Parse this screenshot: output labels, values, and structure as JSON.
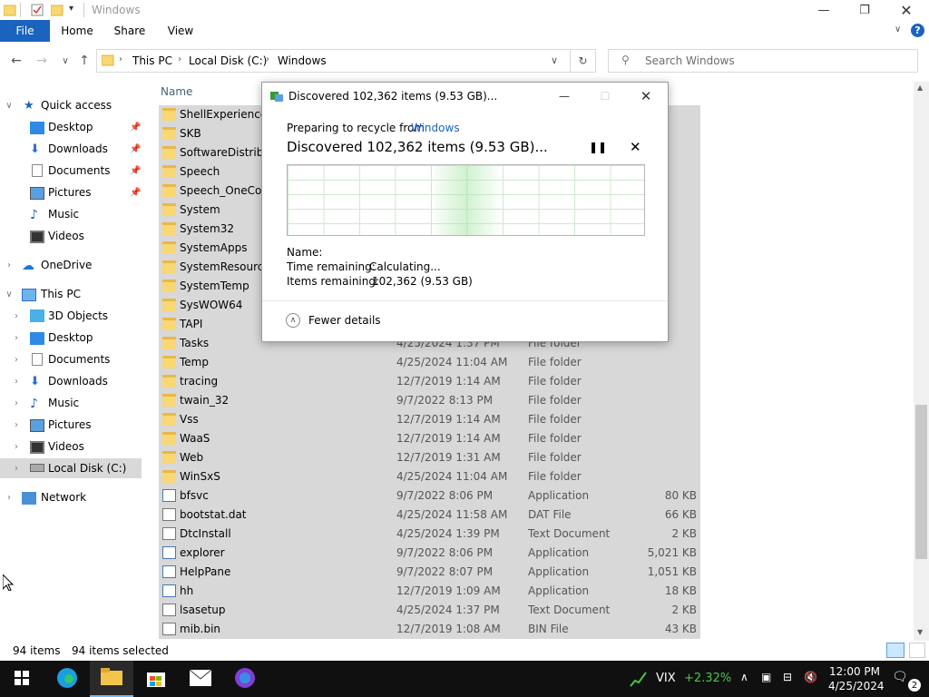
{
  "window": {
    "title": "Windows",
    "ribbon_tabs": [
      "File",
      "Home",
      "Share",
      "View"
    ]
  },
  "address": {
    "crumbs": [
      "This PC",
      "Local Disk (C:)",
      "Windows"
    ],
    "search_placeholder": "Search Windows"
  },
  "nav": {
    "items": [
      {
        "label": "Quick access",
        "icon": "star-icon"
      },
      {
        "label": "Desktop",
        "icon": "desktop-icon"
      },
      {
        "label": "Downloads",
        "icon": "download-icon"
      },
      {
        "label": "Documents",
        "icon": "document-icon"
      },
      {
        "label": "Pictures",
        "icon": "pictures-icon"
      },
      {
        "label": "Music",
        "icon": "music-icon"
      },
      {
        "label": "Videos",
        "icon": "videos-icon"
      },
      {
        "label": "OneDrive",
        "icon": "cloud-icon"
      },
      {
        "label": "This PC",
        "icon": "computer-icon"
      },
      {
        "label": "3D Objects",
        "icon": "cube-icon"
      },
      {
        "label": "Desktop",
        "icon": "desktop-icon"
      },
      {
        "label": "Documents",
        "icon": "document-icon"
      },
      {
        "label": "Downloads",
        "icon": "download-icon"
      },
      {
        "label": "Music",
        "icon": "music-icon"
      },
      {
        "label": "Pictures",
        "icon": "pictures-icon"
      },
      {
        "label": "Videos",
        "icon": "videos-icon"
      },
      {
        "label": "Local Disk (C:)",
        "icon": "drive-icon"
      },
      {
        "label": "Network",
        "icon": "network-icon"
      }
    ]
  },
  "filelist": {
    "header_name": "Name",
    "rows": [
      {
        "name": "ShellExperiences",
        "date": "",
        "type": "",
        "size": "",
        "kind": "folder"
      },
      {
        "name": "SKB",
        "date": "",
        "type": "",
        "size": "",
        "kind": "folder"
      },
      {
        "name": "SoftwareDistribut",
        "date": "",
        "type": "",
        "size": "",
        "kind": "folder"
      },
      {
        "name": "Speech",
        "date": "",
        "type": "",
        "size": "",
        "kind": "folder"
      },
      {
        "name": "Speech_OneCore",
        "date": "",
        "type": "",
        "size": "",
        "kind": "folder"
      },
      {
        "name": "System",
        "date": "",
        "type": "",
        "size": "",
        "kind": "folder"
      },
      {
        "name": "System32",
        "date": "",
        "type": "",
        "size": "",
        "kind": "folder"
      },
      {
        "name": "SystemApps",
        "date": "",
        "type": "",
        "size": "",
        "kind": "folder"
      },
      {
        "name": "SystemResources",
        "date": "",
        "type": "",
        "size": "",
        "kind": "folder"
      },
      {
        "name": "SystemTemp",
        "date": "",
        "type": "",
        "size": "",
        "kind": "folder"
      },
      {
        "name": "SysWOW64",
        "date": "",
        "type": "",
        "size": "",
        "kind": "folder"
      },
      {
        "name": "TAPI",
        "date": "",
        "type": "",
        "size": "",
        "kind": "folder"
      },
      {
        "name": "Tasks",
        "date": "4/25/2024 1:37 PM",
        "type": "File folder",
        "size": "",
        "kind": "folder"
      },
      {
        "name": "Temp",
        "date": "4/25/2024 11:04 AM",
        "type": "File folder",
        "size": "",
        "kind": "folder"
      },
      {
        "name": "tracing",
        "date": "12/7/2019 1:14 AM",
        "type": "File folder",
        "size": "",
        "kind": "folder"
      },
      {
        "name": "twain_32",
        "date": "9/7/2022 8:13 PM",
        "type": "File folder",
        "size": "",
        "kind": "folder"
      },
      {
        "name": "Vss",
        "date": "12/7/2019 1:14 AM",
        "type": "File folder",
        "size": "",
        "kind": "folder"
      },
      {
        "name": "WaaS",
        "date": "12/7/2019 1:14 AM",
        "type": "File folder",
        "size": "",
        "kind": "folder"
      },
      {
        "name": "Web",
        "date": "12/7/2019 1:31 AM",
        "type": "File folder",
        "size": "",
        "kind": "folder"
      },
      {
        "name": "WinSxS",
        "date": "4/25/2024 11:04 AM",
        "type": "File folder",
        "size": "",
        "kind": "folder"
      },
      {
        "name": "bfsvc",
        "date": "9/7/2022 8:06 PM",
        "type": "Application",
        "size": "80 KB",
        "kind": "app"
      },
      {
        "name": "bootstat.dat",
        "date": "4/25/2024 11:58 AM",
        "type": "DAT File",
        "size": "66 KB",
        "kind": "file"
      },
      {
        "name": "DtcInstall",
        "date": "4/25/2024 1:39 PM",
        "type": "Text Document",
        "size": "2 KB",
        "kind": "file"
      },
      {
        "name": "explorer",
        "date": "9/7/2022 8:06 PM",
        "type": "Application",
        "size": "5,021 KB",
        "kind": "app"
      },
      {
        "name": "HelpPane",
        "date": "9/7/2022 8:07 PM",
        "type": "Application",
        "size": "1,051 KB",
        "kind": "app"
      },
      {
        "name": "hh",
        "date": "12/7/2019 1:09 AM",
        "type": "Application",
        "size": "18 KB",
        "kind": "app"
      },
      {
        "name": "lsasetup",
        "date": "4/25/2024 1:37 PM",
        "type": "Text Document",
        "size": "2 KB",
        "kind": "file"
      },
      {
        "name": "mib.bin",
        "date": "12/7/2019 1:08 AM",
        "type": "BIN File",
        "size": "43 KB",
        "kind": "file"
      }
    ]
  },
  "status": {
    "items_count": "94 items",
    "selected_count": "94 items selected"
  },
  "dialog": {
    "title": "Discovered 102,362 items (9.53 GB)...",
    "preparing_prefix": "Preparing to recycle from",
    "preparing_link": "Windows",
    "heading": "Discovered 102,362 items (9.53 GB)...",
    "name_label": "Name:",
    "time_remaining_label": "Time remaining:",
    "time_remaining_value": "Calculating...",
    "items_remaining_label": "Items remaining:",
    "items_remaining_value": "102,362 (9.53 GB)",
    "fewer_details": "Fewer details"
  },
  "taskbar": {
    "stock_name": "VIX",
    "stock_change": "+2.32%",
    "time": "12:00 PM",
    "date": "4/25/2024",
    "notification_count": "2"
  },
  "colors": {
    "accent": "#1a64c0",
    "selection": "#d8d8d8",
    "link": "#1a64c0",
    "stock_positive": "#4cc24c"
  }
}
